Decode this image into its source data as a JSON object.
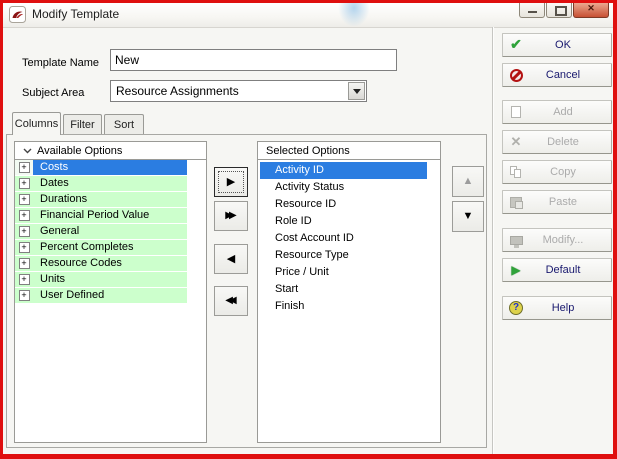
{
  "window": {
    "title": "Modify Template"
  },
  "fields": {
    "template_name": {
      "label": "Template Name",
      "value": "New"
    },
    "subject_area": {
      "label": "Subject Area",
      "value": "Resource Assignments"
    }
  },
  "tabs": [
    {
      "label": "Columns",
      "active": true
    },
    {
      "label": "Filter",
      "active": false
    },
    {
      "label": "Sort",
      "active": false
    }
  ],
  "available": {
    "header": "Available Options",
    "expand_glyph": "+",
    "items": [
      {
        "label": "Costs",
        "selected": true
      },
      {
        "label": "Dates",
        "selected": false
      },
      {
        "label": "Durations",
        "selected": false
      },
      {
        "label": "Financial Period Value",
        "selected": false
      },
      {
        "label": "General",
        "selected": false
      },
      {
        "label": "Percent Completes",
        "selected": false
      },
      {
        "label": "Resource Codes",
        "selected": false
      },
      {
        "label": "Units",
        "selected": false
      },
      {
        "label": "User Defined",
        "selected": false
      }
    ]
  },
  "selected": {
    "header": "Selected Options",
    "items": [
      {
        "label": "Activity ID",
        "selected": true
      },
      {
        "label": "Activity Status",
        "selected": false
      },
      {
        "label": "Resource ID",
        "selected": false
      },
      {
        "label": "Role ID",
        "selected": false
      },
      {
        "label": "Cost Account ID",
        "selected": false
      },
      {
        "label": "Resource Type",
        "selected": false
      },
      {
        "label": "Price / Unit",
        "selected": false
      },
      {
        "label": "Start",
        "selected": false
      },
      {
        "label": "Finish",
        "selected": false
      }
    ]
  },
  "transfer_buttons": [
    {
      "name": "move-right",
      "glyph": "▶",
      "enabled": true,
      "focused": true
    },
    {
      "name": "move-all-right",
      "glyph": "▶▶",
      "enabled": true
    },
    {
      "name": "move-left",
      "glyph": "◀",
      "enabled": true
    },
    {
      "name": "move-all-left",
      "glyph": "◀◀",
      "enabled": true
    }
  ],
  "reorder_buttons": [
    {
      "name": "move-up",
      "glyph": "▲",
      "enabled": false
    },
    {
      "name": "move-down",
      "glyph": "▼",
      "enabled": true
    }
  ],
  "side_buttons": [
    {
      "label": "OK",
      "icon": "check-icon",
      "enabled": true
    },
    {
      "label": "Cancel",
      "icon": "cancel-icon",
      "enabled": true
    },
    {
      "label": "Add",
      "icon": "add-page-icon",
      "enabled": false
    },
    {
      "label": "Delete",
      "icon": "delete-x-icon",
      "enabled": false
    },
    {
      "label": "Copy",
      "icon": "copy-icon",
      "enabled": false
    },
    {
      "label": "Paste",
      "icon": "paste-icon",
      "enabled": false
    },
    {
      "label": "Modify...",
      "icon": "modify-monitor-icon",
      "enabled": false
    },
    {
      "label": "Default",
      "icon": "default-play-icon",
      "enabled": true
    },
    {
      "label": "Help",
      "icon": "help-icon",
      "enabled": true
    }
  ],
  "colors": {
    "annotation_border": "#df0f0f",
    "row_green": "#ccffcc",
    "selection_blue": "#2b7de1",
    "enabled_label": "#18186e",
    "disabled_label": "#ababab"
  }
}
